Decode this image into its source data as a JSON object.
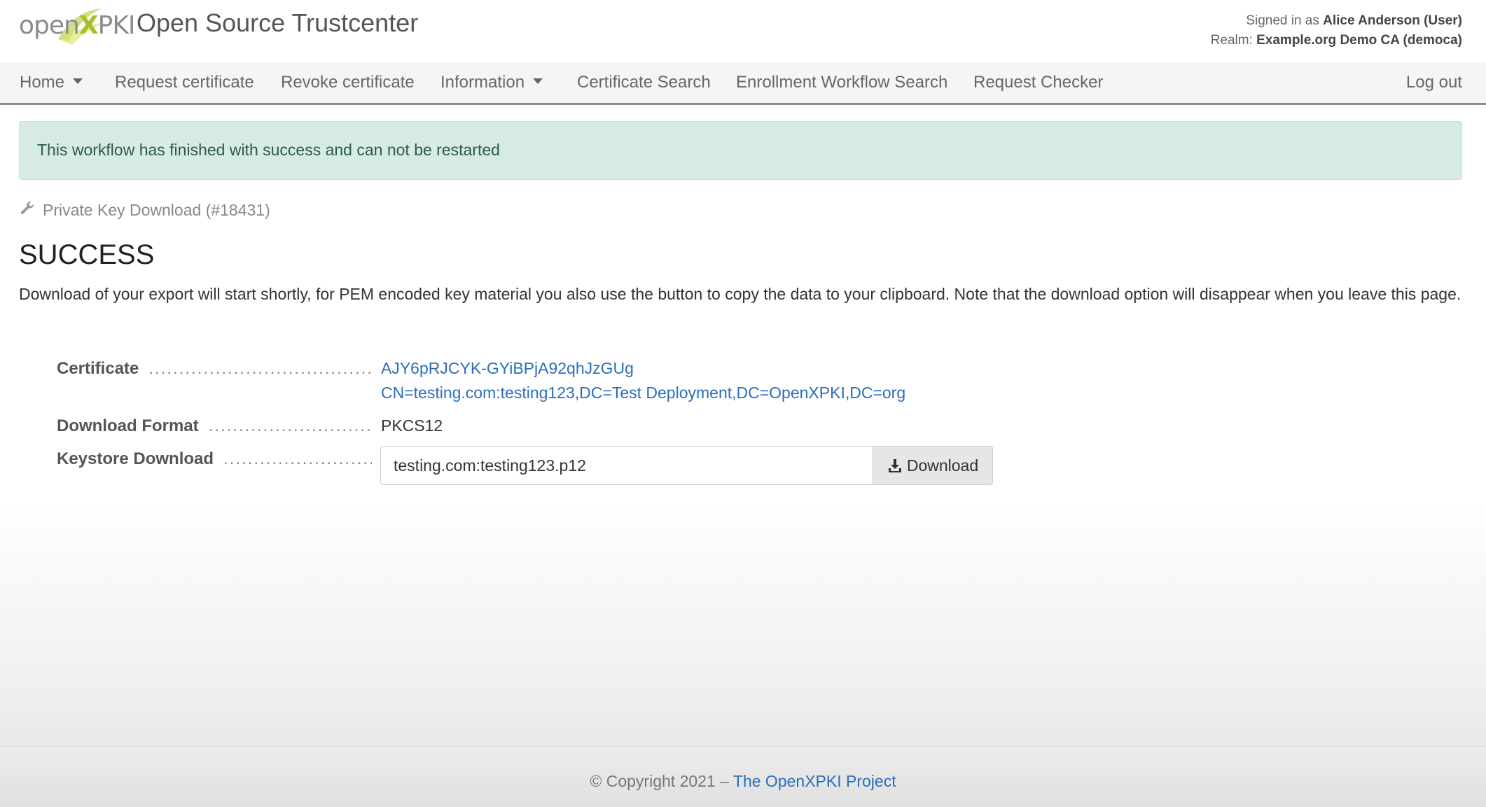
{
  "header": {
    "logo": {
      "part1": "open",
      "part2": "X",
      "part3": "PKI"
    },
    "title": "Open Source Trustcenter",
    "signed_in_prefix": "Signed in as",
    "signed_in_user": "Alice Anderson (User)",
    "realm_prefix": "Realm:",
    "realm_value": "Example.org Demo CA (democa)"
  },
  "nav": {
    "home": "Home",
    "request_certificate": "Request certificate",
    "revoke_certificate": "Revoke certificate",
    "information": "Information",
    "certificate_search": "Certificate Search",
    "enrollment_workflow_search": "Enrollment Workflow Search",
    "request_checker": "Request Checker",
    "logout": "Log out"
  },
  "alert": {
    "message": "This workflow has finished with success and can not be restarted"
  },
  "workflow": {
    "label": "Private Key Download (#18431)",
    "icon": "wrench-icon"
  },
  "page": {
    "title": "SUCCESS",
    "description": "Download of your export will start shortly, for PEM encoded key material you also use the button to copy the data to your clipboard. Note that the download option will disappear when you leave this page."
  },
  "details": {
    "certificate_label": "Certificate",
    "certificate_id": "AJY6pRJCYK-GYiBPjA92qhJzGUg",
    "certificate_dn": "CN=testing.com:testing123,DC=Test Deployment,DC=OpenXPKI,DC=org",
    "format_label": "Download Format",
    "format_value": "PKCS12",
    "keystore_label": "Keystore Download",
    "keystore_value": "testing.com:testing123.p12",
    "download_button": "Download"
  },
  "footer": {
    "copyright": "© Copyright 2021 –",
    "project_link": "The OpenXPKI Project"
  },
  "colors": {
    "link": "#2a6ebb",
    "alert_bg": "#d7ebe5",
    "logo_accent": "#a7bf2b"
  }
}
